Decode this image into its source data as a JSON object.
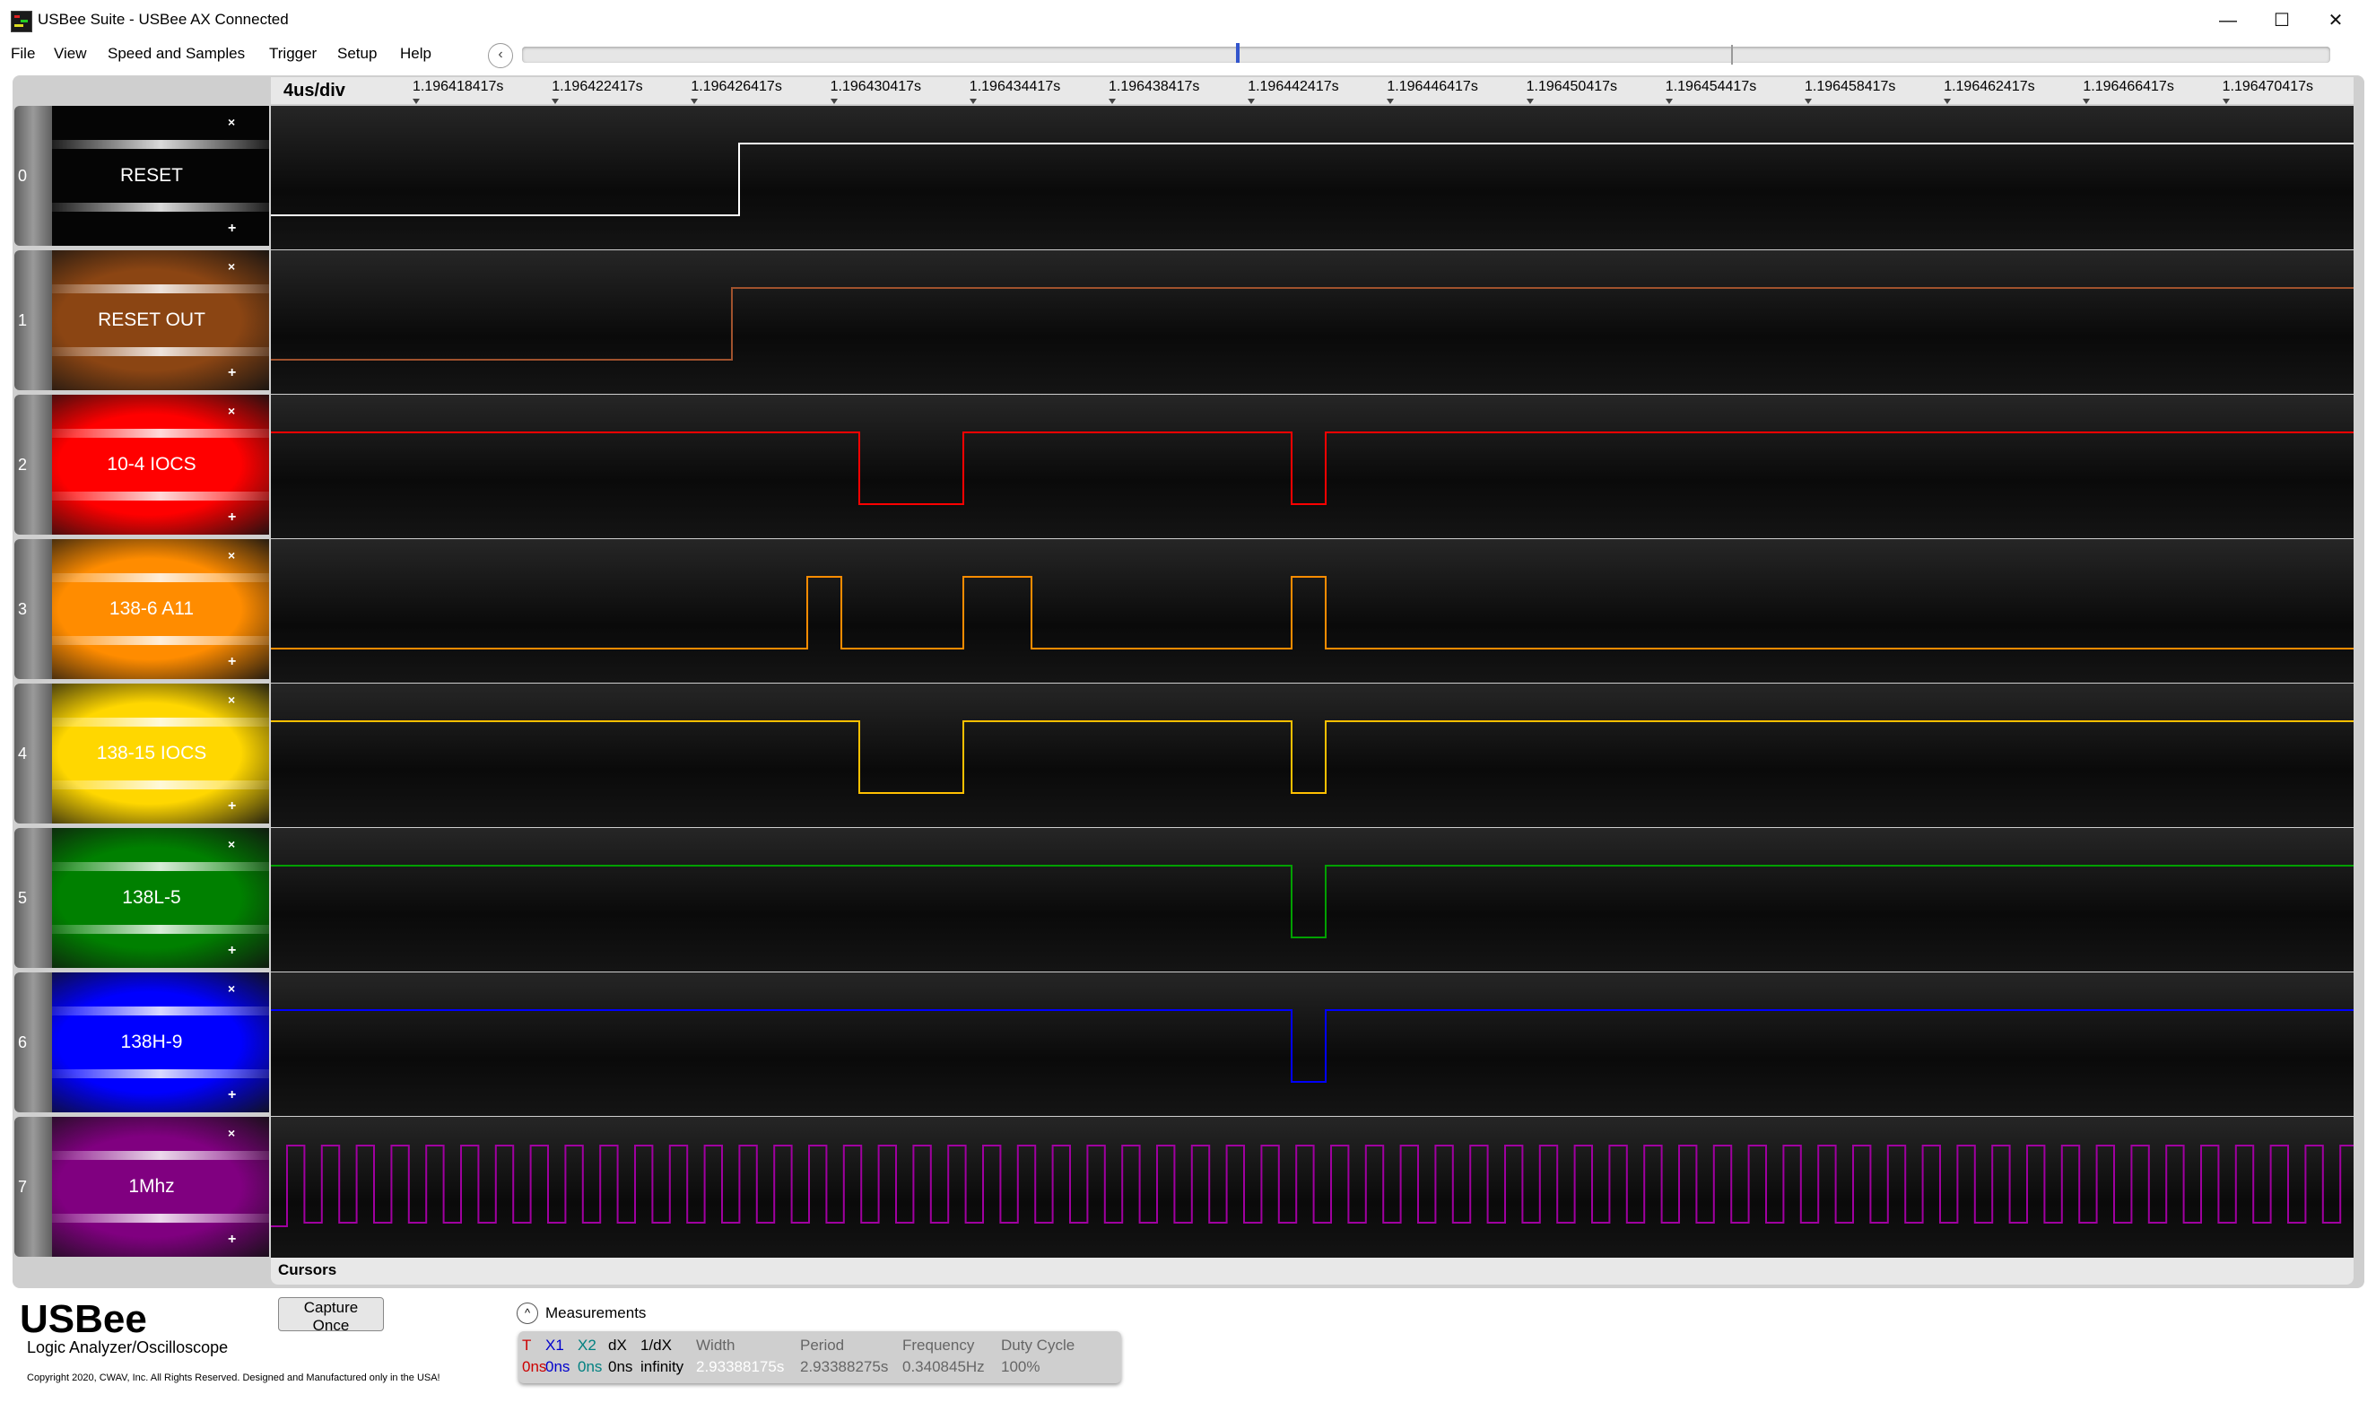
{
  "window": {
    "title": "USBee Suite - USBee AX Connected",
    "minimize_glyph": "—",
    "maximize_glyph": "☐",
    "close_glyph": "✕"
  },
  "menu": [
    "File",
    "View",
    "Speed and Samples",
    "Trigger",
    "Setup",
    "Help"
  ],
  "scroll_left_glyph": "‹",
  "timebar": {
    "division": "4us/div",
    "ticks": [
      "1.196418417s",
      "1.196422417s",
      "1.196426417s",
      "1.196430417s",
      "1.196434417s",
      "1.196438417s",
      "1.196442417s",
      "1.196446417s",
      "1.196450417s",
      "1.196454417s",
      "1.196458417s",
      "1.196462417s",
      "1.196466417s",
      "1.196470417s"
    ]
  },
  "channels": [
    {
      "num": "0",
      "name": "RESET",
      "color": "#000000",
      "trace": "#ffffff",
      "trigger": "rising-edge"
    },
    {
      "num": "1",
      "name": "RESET OUT",
      "color": "#8b4513",
      "trace": "#a0522d",
      "trigger": "none"
    },
    {
      "num": "2",
      "name": "10-4 IOCS",
      "color": "#ff0000",
      "trace": "#ff0000",
      "trigger": "none"
    },
    {
      "num": "3",
      "name": "138-6 A11",
      "color": "#ff8c00",
      "trace": "#ff8c00",
      "trigger": "none"
    },
    {
      "num": "4",
      "name": "138-15 IOCS",
      "color": "#ffd700",
      "trace": "#ffc000",
      "trigger": "none"
    },
    {
      "num": "5",
      "name": "138L-5",
      "color": "#008000",
      "trace": "#00a000",
      "trigger": "none"
    },
    {
      "num": "6",
      "name": "138H-9",
      "color": "#0000ff",
      "trace": "#0000ff",
      "trigger": "none"
    },
    {
      "num": "7",
      "name": "1Mhz",
      "color": "#800080",
      "trace": "#a000a0",
      "trigger": "none"
    }
  ],
  "channel_glyphs": {
    "remove": "×",
    "add": "+"
  },
  "cursors_label": "Cursors",
  "capture_button": "Capture Once",
  "brand": {
    "name": "USBee",
    "subtitle": "Logic Analyzer/Oscilloscope",
    "copyright": "Copyright 2020, CWAV, Inc. All Rights Reserved. Designed and Manufactured only in the USA!"
  },
  "measurements": {
    "toggle_glyph": "^",
    "title": "Measurements",
    "headers": [
      "T",
      "X1",
      "X2",
      "dX",
      "1/dX",
      "Width",
      "Period",
      "Frequency",
      "Duty Cycle"
    ],
    "values": [
      "0ns",
      "0ns",
      "0ns",
      "0ns",
      "infinity",
      "2.93388175s",
      "2.93388275s",
      "0.340845Hz",
      "100%"
    ],
    "colors": [
      "#cc0000",
      "#0000cc",
      "#008080",
      "#000000",
      "#000000",
      "#ffffff",
      "#666666",
      "#666666",
      "#666666"
    ]
  }
}
